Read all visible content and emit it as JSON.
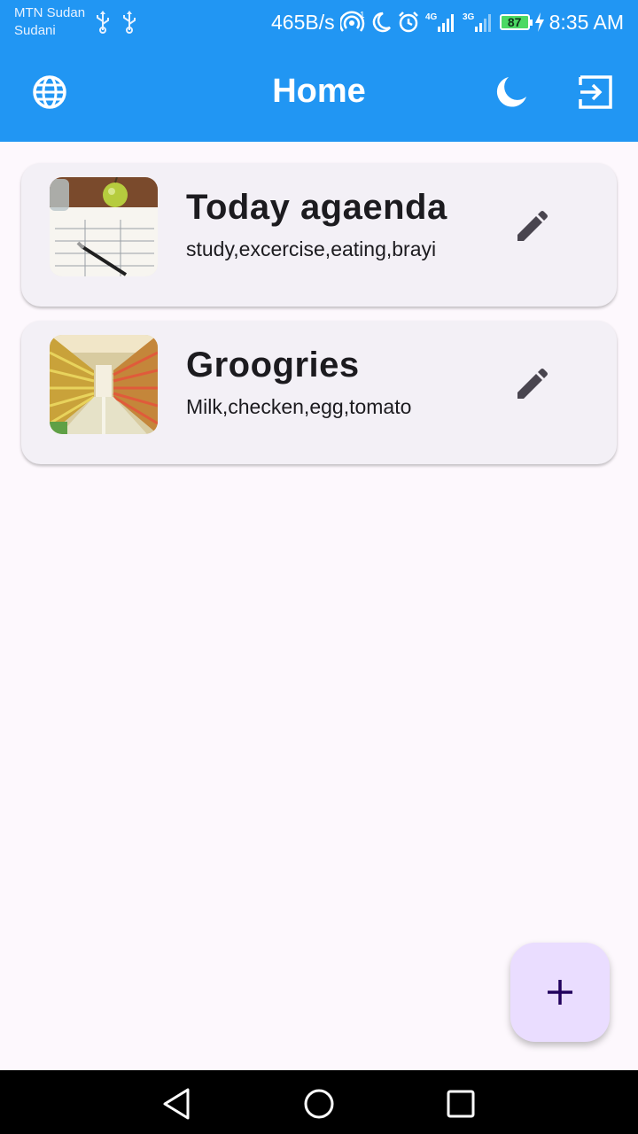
{
  "status_bar": {
    "carrier_line1": "MTN Sudan",
    "carrier_line2": "Sudani",
    "net_speed": "465B/s",
    "signal_1_label": "4G",
    "signal_2_label": "3G",
    "battery": "87",
    "time": "8:35 AM"
  },
  "app_bar": {
    "title": "Home",
    "icons": [
      "globe-icon",
      "dark-mode-icon",
      "logout-icon"
    ],
    "color": "#2196f3"
  },
  "notes": [
    {
      "title": "Today agaenda",
      "subtitle": "study,excercise,eating,brayi",
      "image": "workout-plan-photo"
    },
    {
      "title": "Groogries",
      "subtitle": "Milk,checken,egg,tomato",
      "image": "grocery-aisle-photo"
    }
  ],
  "fab": {
    "icon": "plus-icon",
    "color": "#eaddff"
  },
  "nav_bar": {
    "icons": [
      "back-icon",
      "home-icon",
      "recents-icon"
    ]
  }
}
